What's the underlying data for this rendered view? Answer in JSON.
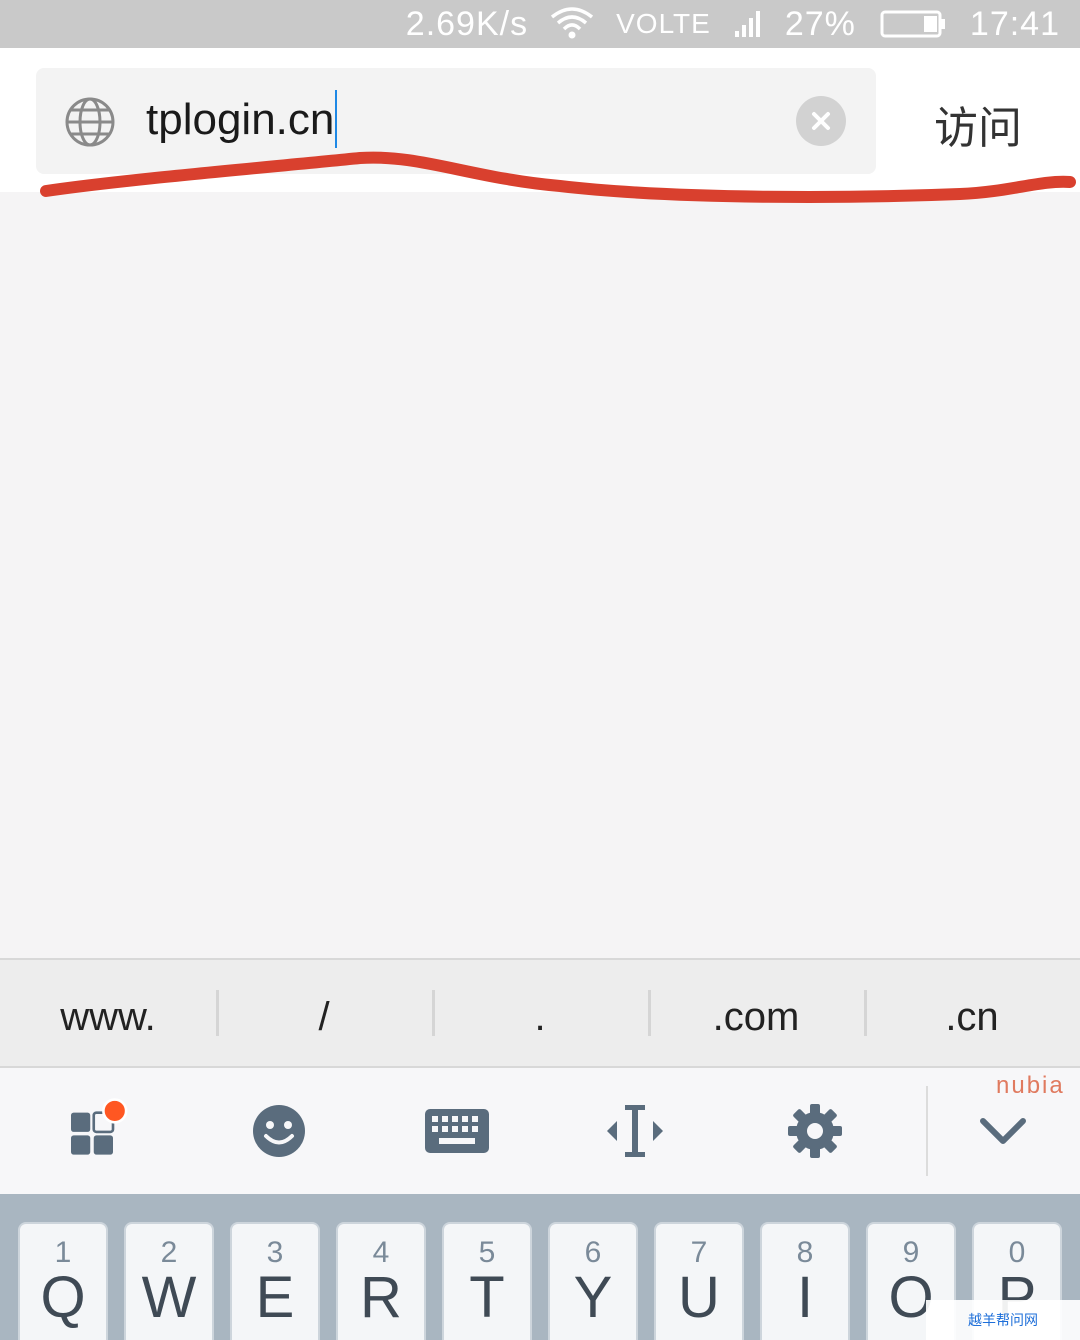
{
  "status_bar": {
    "net_speed": "2.69K/s",
    "network": "VOLTE",
    "battery": "27%",
    "time": "17:41",
    "icons": [
      "wifi-icon",
      "signal-icon",
      "battery-icon"
    ]
  },
  "address_bar": {
    "url": "tplogin.cn",
    "visit_label": "访问",
    "icons": [
      "globe-icon",
      "clear-icon"
    ]
  },
  "suggestions": [
    "www.",
    "/",
    ".",
    ".com",
    ".cn"
  ],
  "toolbar": {
    "brand": "nubia",
    "icons": [
      "apps-icon",
      "emoji-icon",
      "keyboard-icon",
      "cursor-icon",
      "settings-icon",
      "collapse-icon"
    ],
    "badge_color": "#ff5722"
  },
  "keyboard": {
    "keys": [
      {
        "num": "1",
        "ch": "Q"
      },
      {
        "num": "2",
        "ch": "W"
      },
      {
        "num": "3",
        "ch": "E"
      },
      {
        "num": "4",
        "ch": "R"
      },
      {
        "num": "5",
        "ch": "T"
      },
      {
        "num": "6",
        "ch": "Y"
      },
      {
        "num": "7",
        "ch": "U"
      },
      {
        "num": "8",
        "ch": "I"
      },
      {
        "num": "9",
        "ch": "O"
      },
      {
        "num": "0",
        "ch": "P"
      }
    ]
  },
  "watermark": "越羊帮问网",
  "colors": {
    "annotation": "#d9402e",
    "status_bar_bg": "#c9c9c9",
    "keyboard_bg": "#a9b6c1"
  }
}
